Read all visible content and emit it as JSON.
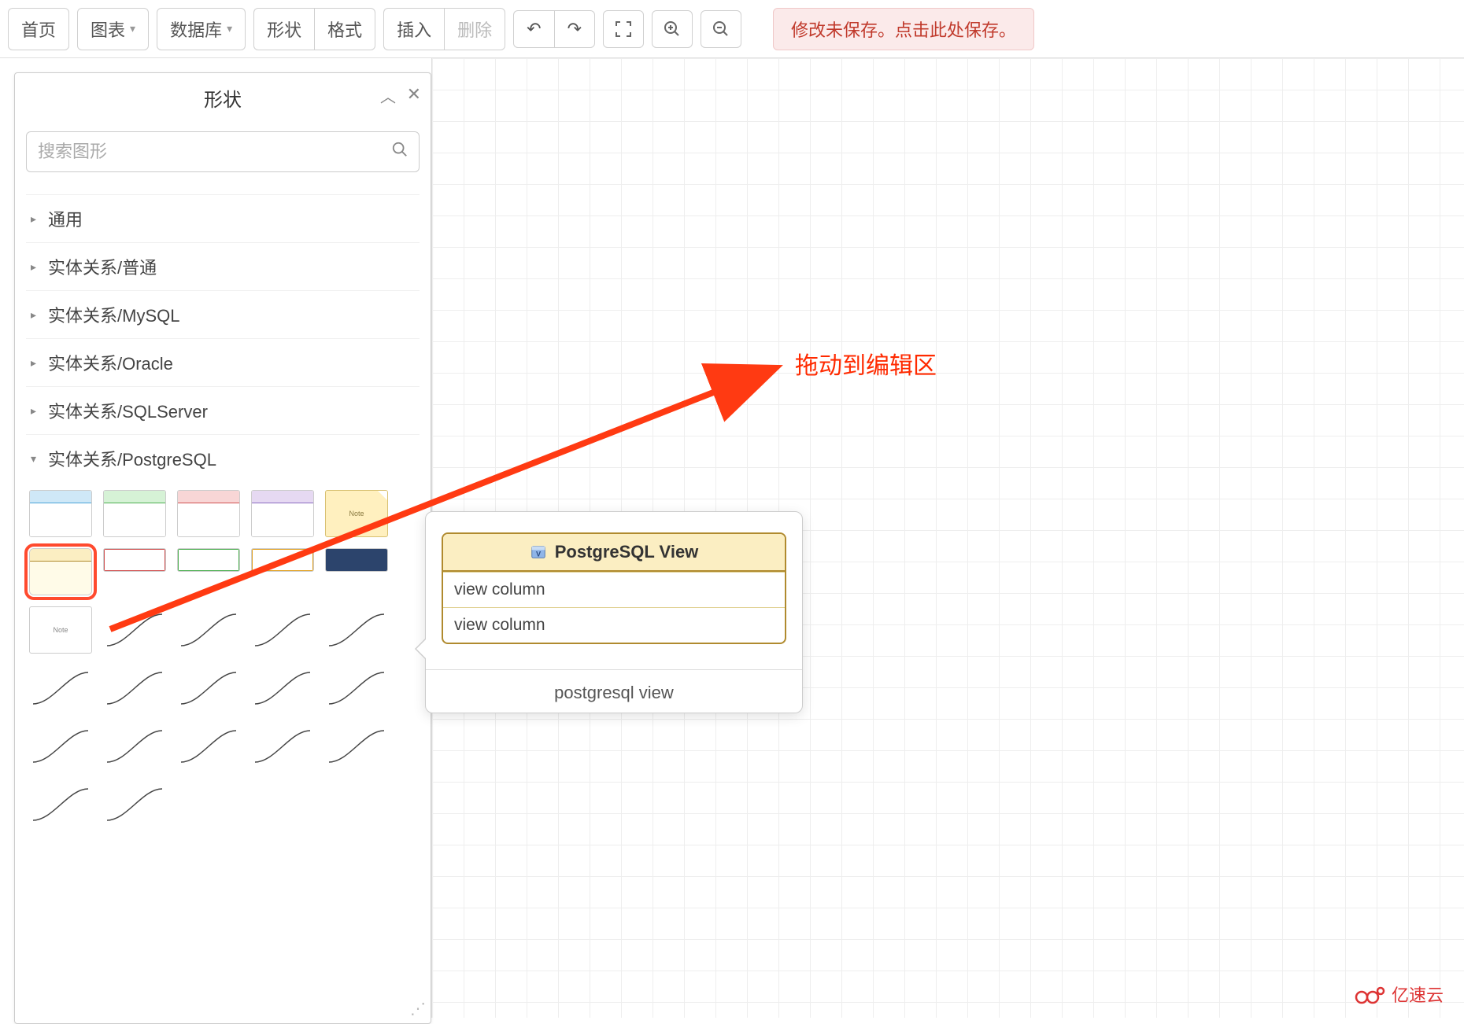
{
  "toolbar": {
    "home": "首页",
    "chart": "图表",
    "database": "数据库",
    "shape": "形状",
    "format": "格式",
    "insert": "插入",
    "delete": "删除"
  },
  "save_banner": "修改未保存。点击此处保存。",
  "panel": {
    "title": "形状",
    "search_placeholder": "搜索图形",
    "categories": [
      {
        "label": "通用",
        "open": false
      },
      {
        "label": "实体关系/普通",
        "open": false
      },
      {
        "label": "实体关系/MySQL",
        "open": false
      },
      {
        "label": "实体关系/Oracle",
        "open": false
      },
      {
        "label": "实体关系/SQLServer",
        "open": false
      },
      {
        "label": "实体关系/PostgreSQL",
        "open": true
      }
    ],
    "shape_note_label": "Note"
  },
  "preview": {
    "title": "PostgreSQL View",
    "rows": [
      "view column",
      "view column"
    ],
    "caption": "postgresql view"
  },
  "annotation": "拖动到编辑区",
  "watermark": "亿速云"
}
